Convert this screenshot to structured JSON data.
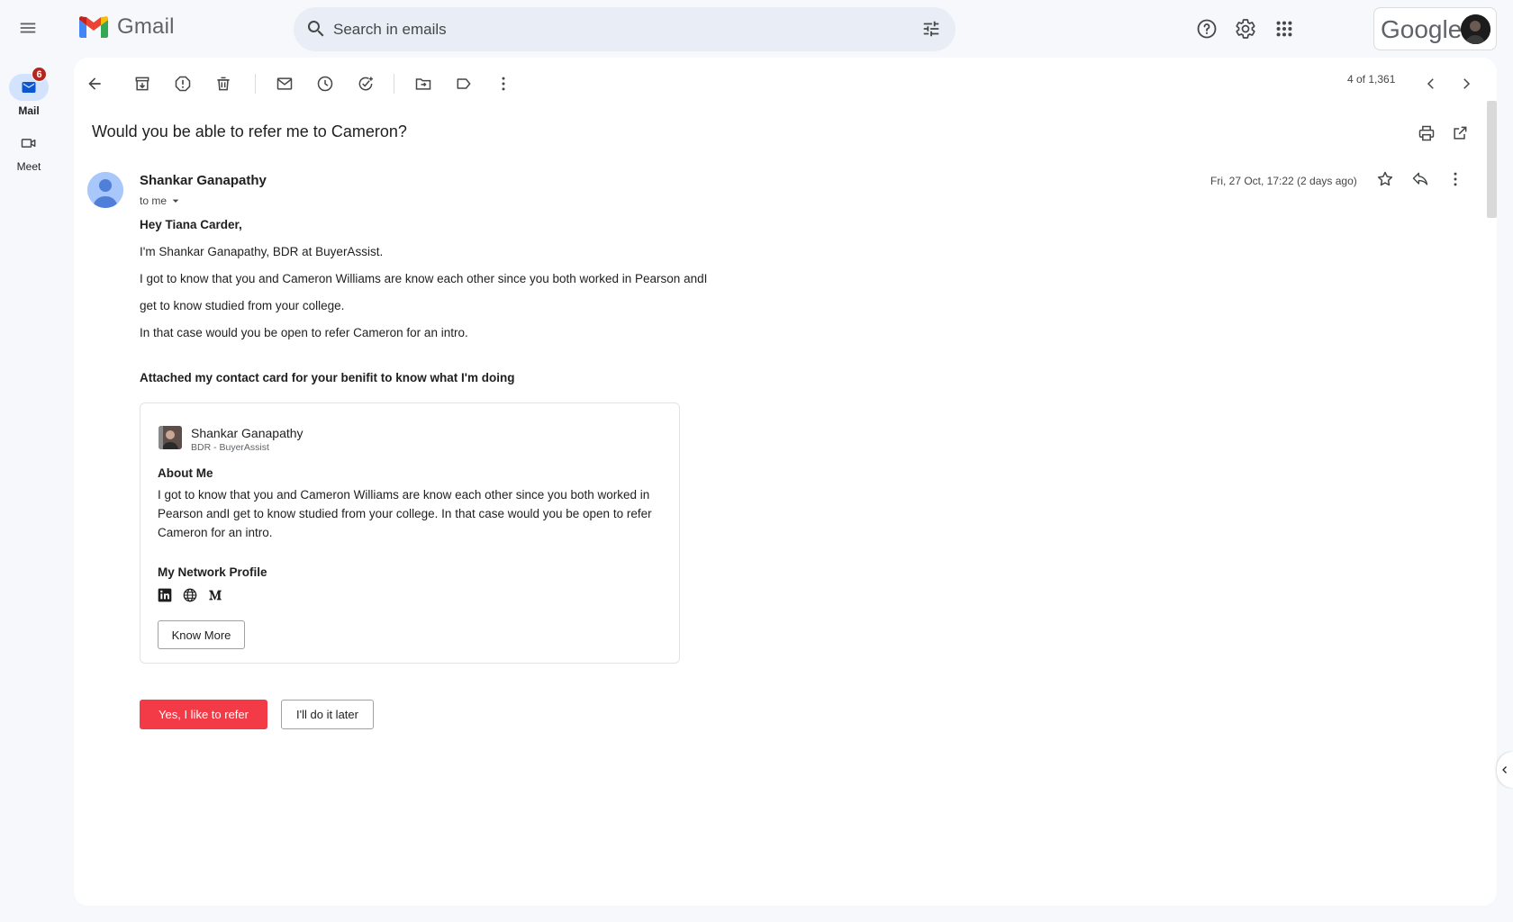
{
  "header": {
    "app_name": "Gmail",
    "search_placeholder": "Search in emails",
    "brand_word": "Google",
    "icons": [
      "main-menu-icon",
      "search-icon",
      "search-options-icon",
      "help-icon",
      "settings-icon",
      "apps-icon"
    ]
  },
  "rail": {
    "items": [
      {
        "label": "Mail",
        "badge": "6",
        "icon": "mail-icon"
      },
      {
        "label": "Meet",
        "icon": "video-icon"
      }
    ]
  },
  "toolbar": {
    "pager_text": "4 of 1,361"
  },
  "message": {
    "subject": "Would you be able to refer me to Cameron?",
    "sender_name": "Shankar Ganapathy",
    "recipient": "to me",
    "date": "Fri, 27 Oct, 17:22 (2 days ago)",
    "greeting": "Hey Tiana Carder,",
    "lines": [
      "I'm Shankar Ganapathy, BDR at BuyerAssist.",
      "I got to know that you and Cameron Williams are know each other since you both worked in Pearson andI",
      "get to know studied from your college.",
      "In that case would you be open to refer Cameron for an intro."
    ],
    "attachment_note": "Attached my contact card for your benifit to know what I'm doing"
  },
  "card": {
    "name": "Shankar Ganapathy",
    "role": "BDR - BuyerAssist",
    "about_heading": "About Me",
    "about_text": "I got to know that you and Cameron Williams are know each other since you both worked in Pearson andI get to know studied from your college. In that case would you be open to refer Cameron for an intro.",
    "network_heading": "My Network Profile",
    "network_icons": [
      "linkedin-icon",
      "globe-icon",
      "medium-icon"
    ],
    "know_more_label": "Know More"
  },
  "actions": {
    "primary_label": "Yes, I like to refer",
    "secondary_label": "I'll do it later"
  },
  "colors": {
    "accent_red": "#f23b47",
    "badge_red": "#b3261e",
    "search_bg": "#e9eef6",
    "page_bg": "#f6f8fc",
    "mail_pill": "#d3e3fd"
  }
}
